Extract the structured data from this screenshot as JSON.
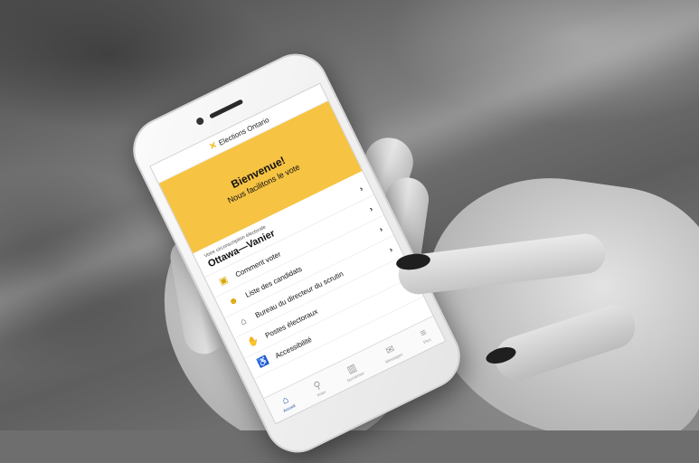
{
  "app": {
    "brand": "Elections Ontario",
    "brand_mark": "✕"
  },
  "hero": {
    "title": "Bienvenue!",
    "subtitle": "Nous facilitons le vote"
  },
  "riding": {
    "label": "Votre circonscription électorale",
    "name": "Ottawa—Vanier"
  },
  "menu": [
    {
      "label": "Comment voter",
      "icon": "ballot-box-icon"
    },
    {
      "label": "Liste des candidats",
      "icon": "candidates-icon"
    },
    {
      "label": "Bureau du directeur du scrutin",
      "icon": "office-home-icon"
    },
    {
      "label": "Postes électoraux",
      "icon": "handshake-icon"
    },
    {
      "label": "Accessibilité",
      "icon": "wheelchair-icon"
    }
  ],
  "tabs": [
    {
      "label": "Accueil",
      "icon": "home-icon",
      "active": true
    },
    {
      "label": "Voter",
      "icon": "location-pin-icon",
      "active": false
    },
    {
      "label": "Numériser",
      "icon": "barcode-icon",
      "active": false
    },
    {
      "label": "Messages",
      "icon": "mail-icon",
      "active": false
    },
    {
      "label": "Plus",
      "icon": "menu-icon",
      "active": false
    }
  ],
  "colors": {
    "brand_yellow": "#f6c343",
    "active_tab": "#1d4fa1"
  }
}
